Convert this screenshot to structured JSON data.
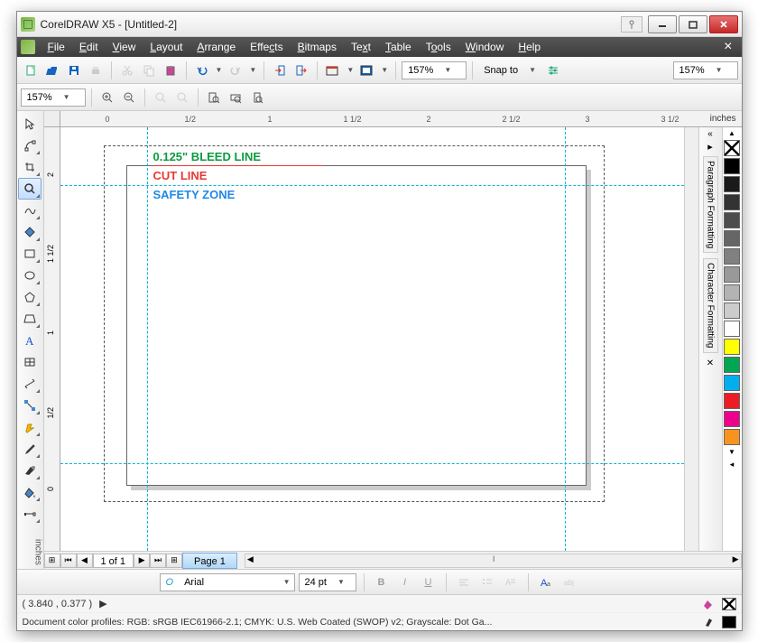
{
  "title": "CorelDRAW X5 - [Untitled-2]",
  "menu": [
    "File",
    "Edit",
    "View",
    "Layout",
    "Arrange",
    "Effects",
    "Bitmaps",
    "Text",
    "Table",
    "Tools",
    "Window",
    "Help"
  ],
  "toolbar": {
    "zoom1": "157%",
    "snap_label": "Snap to",
    "zoom2": "157%"
  },
  "toolbar2": {
    "zoom": "157%"
  },
  "ruler": {
    "unit": "inches",
    "hticks": [
      "0",
      "1/2",
      "1",
      "1 1/2",
      "2",
      "2 1/2",
      "3",
      "3 1/2"
    ],
    "vticks": [
      "2",
      "1 1/2",
      "1",
      "1/2",
      "0"
    ]
  },
  "canvas": {
    "bleed_label": "0.125\" BLEED LINE",
    "cut_label": "CUT LINE",
    "safety_label": "SAFETY ZONE"
  },
  "dockers": [
    "Paragraph Formatting",
    "Character Formatting"
  ],
  "palette": [
    "#ffffff",
    "#000000",
    "#1a1a1a",
    "#333333",
    "#4d4d4d",
    "#666666",
    "#808080",
    "#999999",
    "#b3b3b3",
    "#cccccc",
    "#ffffff",
    "#ffff00",
    "#00a651",
    "#00aeef",
    "#ed1c24",
    "#ec008c",
    "#f7941d"
  ],
  "pages": {
    "counter": "1 of 1",
    "tab": "Page 1"
  },
  "propbar": {
    "font": "Arial",
    "size": "24 pt"
  },
  "status1": {
    "coords": "( 3.840 , 0.377 )"
  },
  "status2": {
    "profiles": "Document color profiles: RGB: sRGB IEC61966-2.1; CMYK: U.S. Web Coated (SWOP) v2; Grayscale: Dot Ga..."
  }
}
